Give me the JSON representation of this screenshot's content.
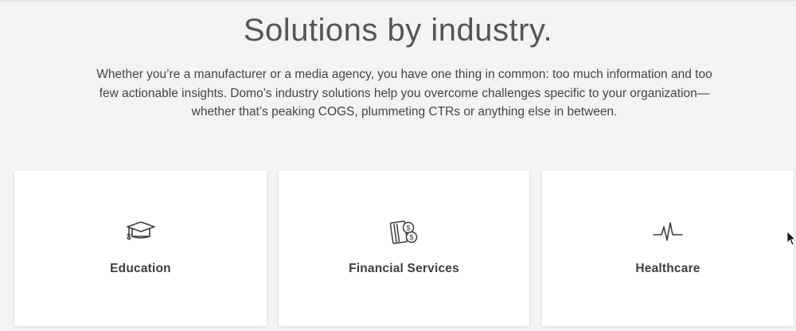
{
  "section": {
    "title": "Solutions by industry.",
    "intro_lines": [
      "Whether you’re a manufacturer or a media agency, you have one thing in common: too much information and too",
      "few actionable insights. Domo’s industry solutions help you overcome challenges specific to your organization—",
      "whether that’s peaking COGS, plummeting CTRs or anything else in between."
    ]
  },
  "cards": [
    {
      "label": "Education",
      "icon": "graduation-cap-icon"
    },
    {
      "label": "Financial Services",
      "icon": "card-and-coins-icon"
    },
    {
      "label": "Healthcare",
      "icon": "heartbeat-line-icon"
    }
  ],
  "colors": {
    "background": "#f4f3f4",
    "card": "#ffffff",
    "heading": "#55555a",
    "text": "#444448"
  }
}
